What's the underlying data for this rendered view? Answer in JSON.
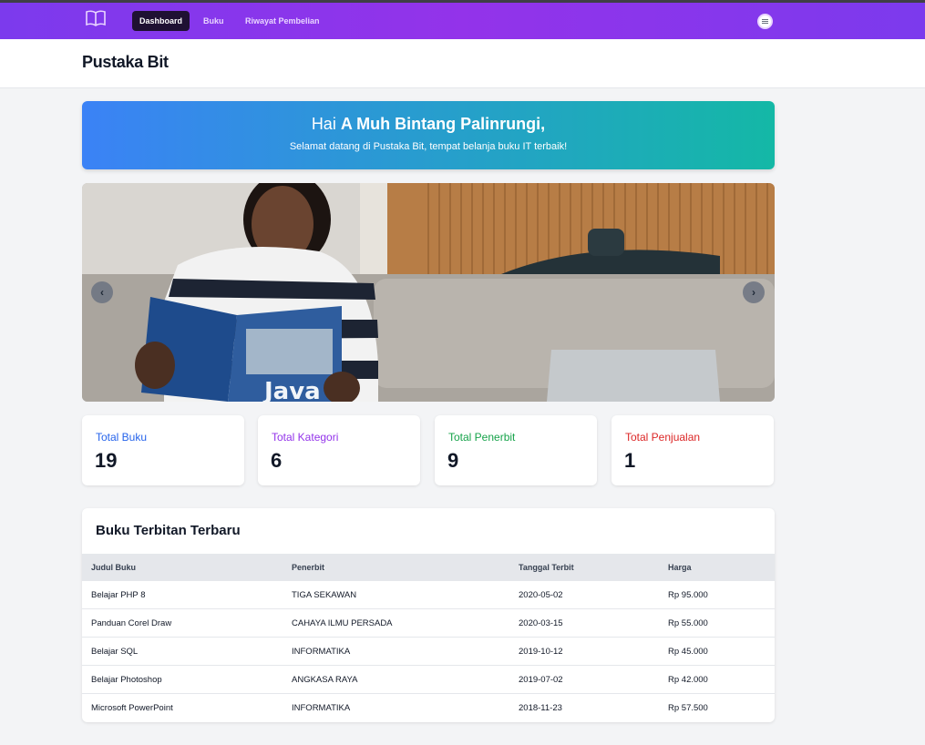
{
  "nav": {
    "logo_icon": "book-open-icon",
    "items": [
      {
        "label": "Dashboard",
        "active": true
      },
      {
        "label": "Buku",
        "active": false
      },
      {
        "label": "Riwayat Pembelian",
        "active": false
      }
    ],
    "profile_icon": "profile-menu-icon"
  },
  "header": {
    "title": "Pustaka Bit"
  },
  "welcome": {
    "greeting": "Hai",
    "name": "A Muh Bintang Palinrungi,",
    "subtitle": "Selamat datang di Pustaka Bit, tempat belanja buku IT terbaik!"
  },
  "carousel": {
    "prev_icon": "chevron-left-icon",
    "next_icon": "chevron-right-icon",
    "prev_glyph": "‹",
    "next_glyph": "›",
    "image_book_text": "Java"
  },
  "stats": [
    {
      "label": "Total Buku",
      "value": "19",
      "color": "#2563eb"
    },
    {
      "label": "Total Kategori",
      "value": "6",
      "color": "#9333ea"
    },
    {
      "label": "Total Penerbit",
      "value": "9",
      "color": "#16a34a"
    },
    {
      "label": "Total Penjualan",
      "value": "1",
      "color": "#dc2626"
    }
  ],
  "latest_books": {
    "title": "Buku Terbitan Terbaru",
    "columns": [
      "Judul Buku",
      "Penerbit",
      "Tanggal Terbit",
      "Harga"
    ],
    "rows": [
      [
        "Belajar PHP 8",
        "TIGA SEKAWAN",
        "2020-05-02",
        "Rp 95.000"
      ],
      [
        "Panduan Corel Draw",
        "CAHAYA ILMU PERSADA",
        "2020-03-15",
        "Rp 55.000"
      ],
      [
        "Belajar SQL",
        "INFORMATIKA",
        "2019-10-12",
        "Rp 45.000"
      ],
      [
        "Belajar Photoshop",
        "ANGKASA RAYA",
        "2019-07-02",
        "Rp 42.000"
      ],
      [
        "Microsoft PowerPoint",
        "INFORMATIKA",
        "2018-11-23",
        "Rp 57.500"
      ]
    ]
  },
  "colors": {
    "nav_gradient": [
      "#7c3aed",
      "#9333ea"
    ],
    "welcome_gradient": [
      "#3b82f6",
      "#14b8a6"
    ]
  }
}
